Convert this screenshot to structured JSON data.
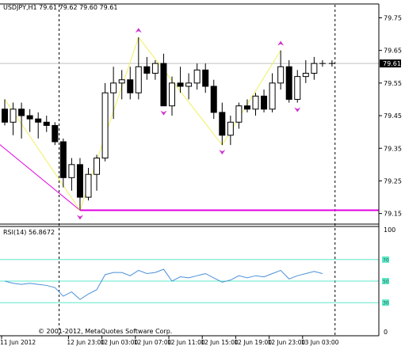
{
  "chart_data": [
    {
      "type": "candlestick",
      "symbol_header": "USDJPY,H1  79.61 79.62 79.60 79.61",
      "ylim": [
        79.12,
        79.79
      ],
      "y_ticks": [
        "79.75",
        "79.65",
        "79.55",
        "79.45",
        "79.35",
        "79.25",
        "79.15"
      ],
      "y_tick_values": [
        79.75,
        79.65,
        79.55,
        79.45,
        79.35,
        79.25,
        79.15
      ],
      "x_labels": [
        "11 Jun 2012",
        "12 Jun 23:00",
        "12 Jun 03:00",
        "12 Jun 07:00",
        "12 Jun 11:00",
        "12 Jun 15:00",
        "12 Jun 19:00",
        "12 Jun 23:00",
        "13 Jun 03:00"
      ],
      "x_label_bars": [
        0,
        8,
        12,
        16,
        20,
        24,
        28,
        32,
        36
      ],
      "current_price_label": "79.61",
      "current_price": 79.61,
      "period_separators_at_bar": [
        7,
        40
      ],
      "candles": [
        {
          "o": 79.47,
          "h": 79.5,
          "l": 79.42,
          "c": 79.43
        },
        {
          "o": 79.43,
          "h": 79.49,
          "l": 79.39,
          "c": 79.47
        },
        {
          "o": 79.47,
          "h": 79.49,
          "l": 79.38,
          "c": 79.45
        },
        {
          "o": 79.45,
          "h": 79.47,
          "l": 79.4,
          "c": 79.44
        },
        {
          "o": 79.44,
          "h": 79.46,
          "l": 79.38,
          "c": 79.43
        },
        {
          "o": 79.43,
          "h": 79.45,
          "l": 79.4,
          "c": 79.42
        },
        {
          "o": 79.42,
          "h": 79.43,
          "l": 79.36,
          "c": 79.37
        },
        {
          "o": 79.37,
          "h": 79.38,
          "l": 79.23,
          "c": 79.26
        },
        {
          "o": 79.26,
          "h": 79.32,
          "l": 79.22,
          "c": 79.3
        },
        {
          "o": 79.3,
          "h": 79.32,
          "l": 79.16,
          "c": 79.2
        },
        {
          "o": 79.2,
          "h": 79.29,
          "l": 79.19,
          "c": 79.27
        },
        {
          "o": 79.27,
          "h": 79.33,
          "l": 79.22,
          "c": 79.32
        },
        {
          "o": 79.32,
          "h": 79.55,
          "l": 79.31,
          "c": 79.52
        },
        {
          "o": 79.52,
          "h": 79.6,
          "l": 79.44,
          "c": 79.55
        },
        {
          "o": 79.55,
          "h": 79.59,
          "l": 79.5,
          "c": 79.56
        },
        {
          "o": 79.56,
          "h": 79.6,
          "l": 79.5,
          "c": 79.52
        },
        {
          "o": 79.52,
          "h": 79.69,
          "l": 79.5,
          "c": 79.6
        },
        {
          "o": 79.6,
          "h": 79.63,
          "l": 79.56,
          "c": 79.58
        },
        {
          "o": 79.58,
          "h": 79.62,
          "l": 79.56,
          "c": 79.61
        },
        {
          "o": 79.61,
          "h": 79.64,
          "l": 79.48,
          "c": 79.48
        },
        {
          "o": 79.48,
          "h": 79.57,
          "l": 79.45,
          "c": 79.55
        },
        {
          "o": 79.55,
          "h": 79.6,
          "l": 79.52,
          "c": 79.54
        },
        {
          "o": 79.54,
          "h": 79.58,
          "l": 79.5,
          "c": 79.55
        },
        {
          "o": 79.55,
          "h": 79.61,
          "l": 79.53,
          "c": 79.59
        },
        {
          "o": 79.59,
          "h": 79.61,
          "l": 79.52,
          "c": 79.54
        },
        {
          "o": 79.54,
          "h": 79.56,
          "l": 79.44,
          "c": 79.46
        },
        {
          "o": 79.46,
          "h": 79.49,
          "l": 79.36,
          "c": 79.39
        },
        {
          "o": 79.39,
          "h": 79.45,
          "l": 79.36,
          "c": 79.43
        },
        {
          "o": 79.43,
          "h": 79.49,
          "l": 79.41,
          "c": 79.48
        },
        {
          "o": 79.48,
          "h": 79.5,
          "l": 79.46,
          "c": 79.47
        },
        {
          "o": 79.47,
          "h": 79.52,
          "l": 79.45,
          "c": 79.51
        },
        {
          "o": 79.51,
          "h": 79.53,
          "l": 79.46,
          "c": 79.47
        },
        {
          "o": 79.47,
          "h": 79.58,
          "l": 79.46,
          "c": 79.55
        },
        {
          "o": 79.55,
          "h": 79.65,
          "l": 79.53,
          "c": 79.6
        },
        {
          "o": 79.6,
          "h": 79.62,
          "l": 79.49,
          "c": 79.5
        },
        {
          "o": 79.5,
          "h": 79.59,
          "l": 79.49,
          "c": 79.57
        },
        {
          "o": 79.57,
          "h": 79.62,
          "l": 79.55,
          "c": 79.58
        },
        {
          "o": 79.58,
          "h": 79.63,
          "l": 79.56,
          "c": 79.61
        },
        {
          "o": 79.61,
          "h": 79.62,
          "l": 79.6,
          "c": 79.61
        }
      ],
      "zigzag": [
        {
          "bar": 0,
          "price": 79.5
        },
        {
          "bar": 9,
          "price": 79.16
        },
        {
          "bar": 16,
          "price": 79.69
        },
        {
          "bar": 26,
          "price": 79.36
        },
        {
          "bar": 33,
          "price": 79.65
        }
      ],
      "swing_arrows": [
        {
          "bar": 9,
          "price": 79.16,
          "dir": "down"
        },
        {
          "bar": 16,
          "price": 79.69,
          "dir": "up"
        },
        {
          "bar": 19,
          "price": 79.48,
          "dir": "down"
        },
        {
          "bar": 26,
          "price": 79.36,
          "dir": "down"
        },
        {
          "bar": 33,
          "price": 79.65,
          "dir": "up"
        },
        {
          "bar": 35,
          "price": 79.49,
          "dir": "down"
        }
      ],
      "horizontal_line_price": 79.16,
      "trend_line": {
        "from": {
          "bar": -1,
          "price": 79.37
        },
        "to": {
          "bar": 9,
          "price": 79.16
        }
      },
      "colors": {
        "zigzag": "#f0f060",
        "arrows": "#cc33cc",
        "horizontal_line": "#e000e0",
        "trend_line": "#e000e0",
        "separator": "#000000",
        "candle": "#000000",
        "current_price_line": "#c0c0c0"
      }
    },
    {
      "type": "line",
      "label": "RSI(14) 56.8672",
      "ylim": [
        0,
        100
      ],
      "y_ticks": [
        "100",
        "0"
      ],
      "y_tick_values": [
        100,
        0
      ],
      "level_values": [
        70,
        50,
        30
      ],
      "level_tags": [
        "70",
        "50",
        "30"
      ],
      "series": [
        {
          "values": [
            50,
            48,
            47,
            48,
            47,
            46,
            44,
            36,
            40,
            33,
            38,
            42,
            56,
            58,
            58,
            55,
            60,
            57,
            58,
            61,
            50,
            54,
            53,
            55,
            57,
            53,
            49,
            51,
            55,
            53,
            55,
            54,
            57,
            60,
            52,
            55,
            57,
            59,
            57
          ]
        }
      ],
      "colors": {
        "line": "#4a90d9",
        "levels": "#5fe8c8"
      }
    }
  ],
  "copyright": "© 2001-2012, MetaQuotes Software Corp."
}
